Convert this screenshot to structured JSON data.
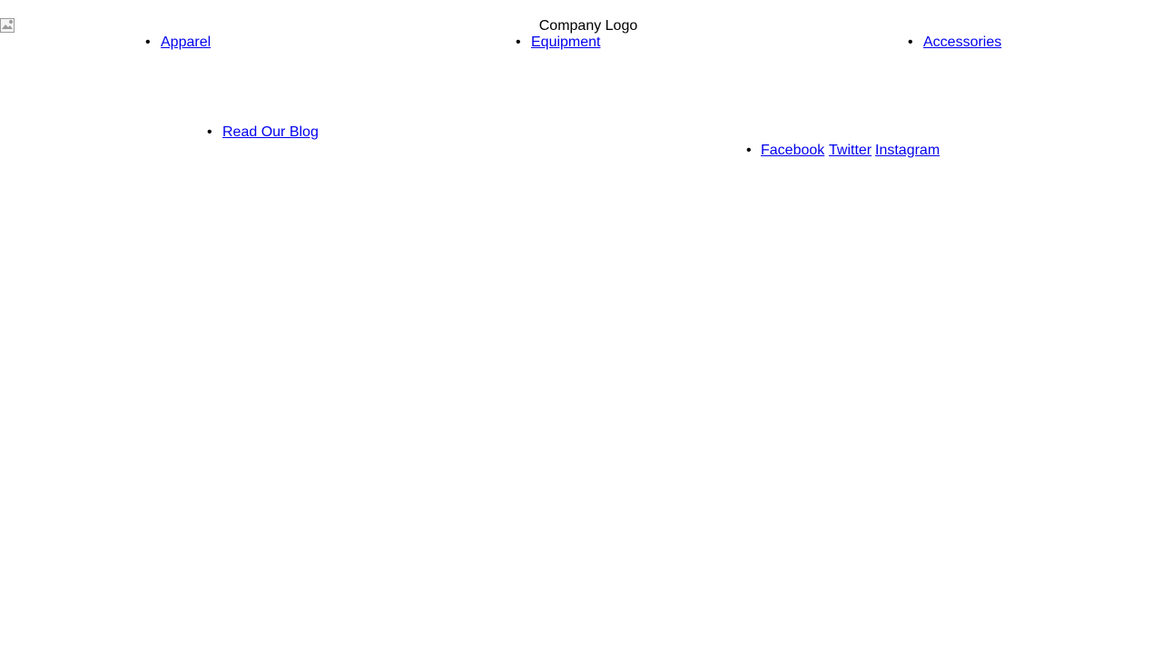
{
  "header": {
    "logo": {
      "icon": "broken-image-icon",
      "text": "Company Logo"
    },
    "nav_items": [
      {
        "label": "Apparel"
      },
      {
        "label": "Equipment"
      },
      {
        "label": "Accessories"
      }
    ]
  },
  "blog": {
    "label": "Read Our Blog"
  },
  "social": {
    "links": [
      {
        "label": "Facebook"
      },
      {
        "label": "Twitter"
      },
      {
        "label": "Instagram"
      }
    ]
  },
  "colors": {
    "link": "#0000ee",
    "text": "#000000",
    "background": "#ffffff"
  }
}
